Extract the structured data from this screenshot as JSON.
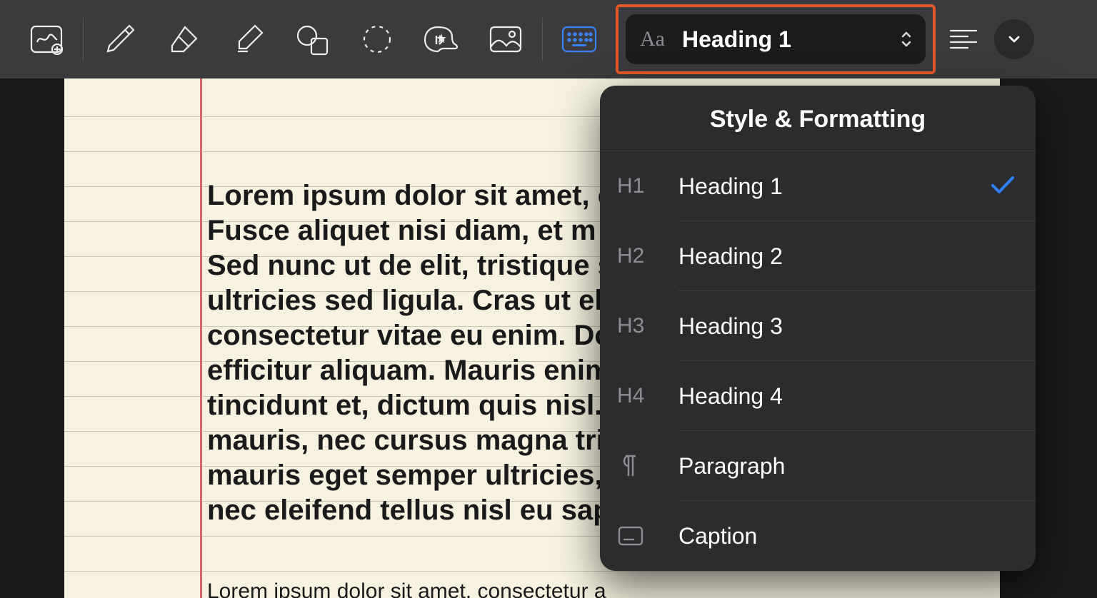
{
  "toolbar": {
    "style_picker_label": "Heading 1"
  },
  "popover": {
    "title": "Style & Formatting",
    "items": [
      {
        "hint": "H1",
        "name": "Heading 1",
        "selected": true
      },
      {
        "hint": "H2",
        "name": "Heading 2",
        "selected": false
      },
      {
        "hint": "H3",
        "name": "Heading 3",
        "selected": false
      },
      {
        "hint": "H4",
        "name": "Heading 4",
        "selected": false
      },
      {
        "hint": "pilcrow",
        "name": "Paragraph",
        "selected": false
      },
      {
        "hint": "caption-icon",
        "name": "Caption",
        "selected": false
      }
    ]
  },
  "document": {
    "paragraph1": "Lorem ipsum dolor sit amet, c\nFusce aliquet nisi diam, et m\nSed nunc ut de elit, tristique s\nultricies sed ligula. Cras ut el\nconsectetur vitae eu enim. Do\nefficitur aliquam. Mauris enim\ntincidunt et, dictum quis nisl.\nmauris, nec cursus magna tris\nmauris eget semper ultricies,\nnec eleifend tellus nisl eu sap",
    "paragraph2": "Lorem ipsum dolor sit amet, consectetur a"
  }
}
